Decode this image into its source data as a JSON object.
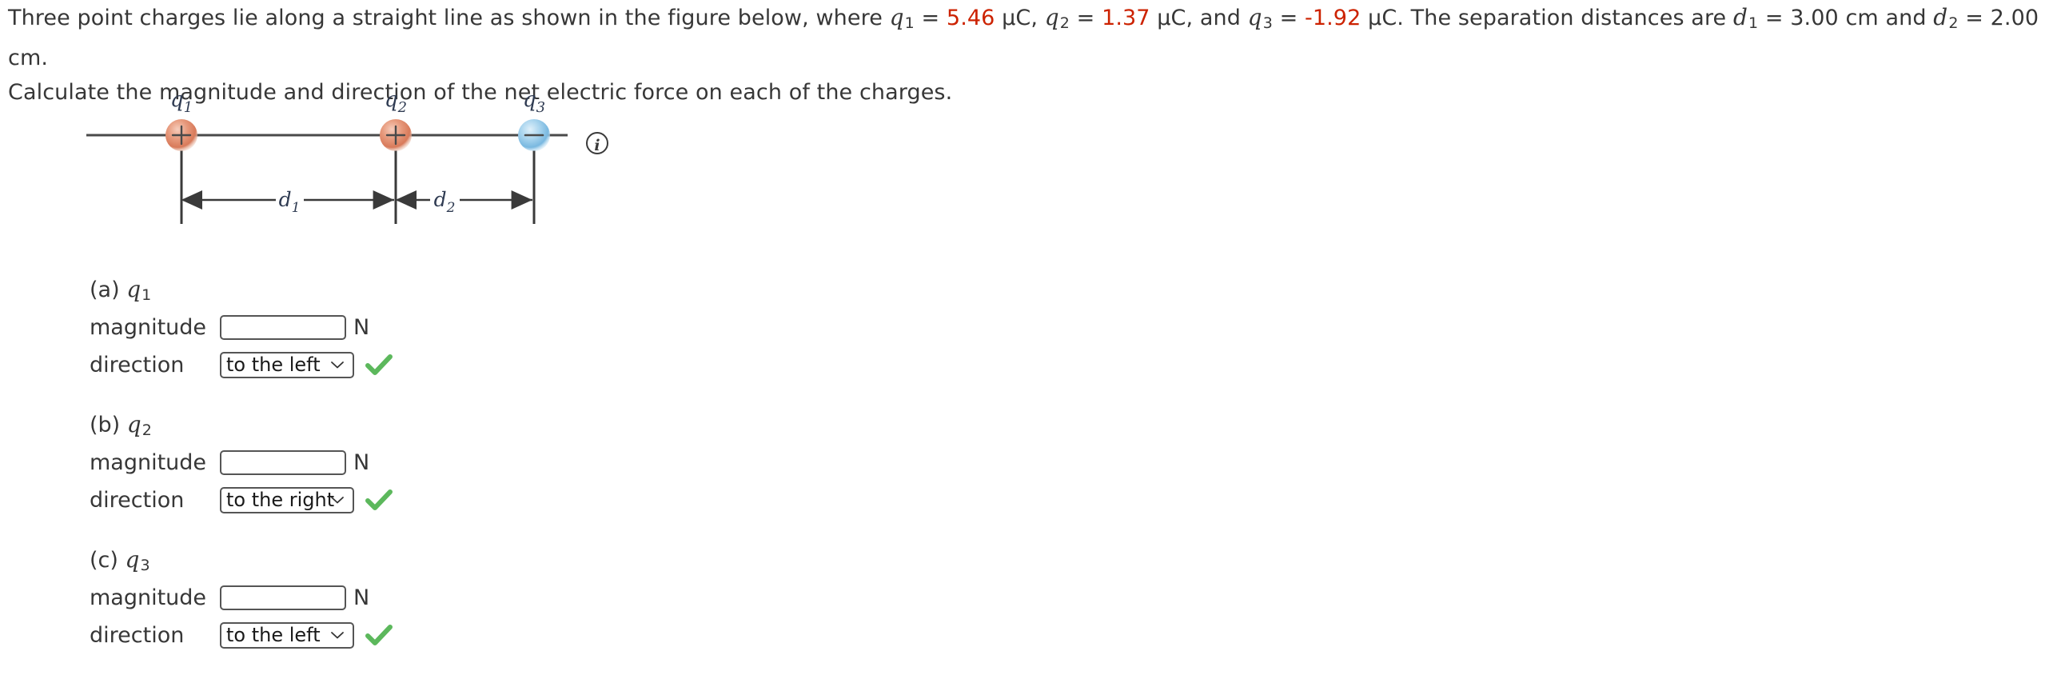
{
  "problem": {
    "line1_part1": "Three point charges lie along a straight line as shown in the figure below, where ",
    "q1_sym": "q",
    "q1_sub": "1",
    "eq1": " = ",
    "q1_val": "5.46",
    "unit1": " µC, ",
    "q2_sym": "q",
    "q2_sub": "2",
    "eq2": " = ",
    "q2_val": "1.37",
    "unit2": " µC, and ",
    "q3_sym": "q",
    "q3_sub": "3",
    "eq3": " = ",
    "q3_val": "-1.92",
    "unit3": " µC. The separation distances are ",
    "d1_sym": "d",
    "d1_sub": "1",
    "eq4": " = ",
    "d1_val": "3.00 cm",
    "and_text": " and ",
    "d2_sym": "d",
    "d2_sub": "2",
    "eq5": " = ",
    "d2_val": "2.00 cm",
    "period": ".",
    "line2": "Calculate the magnitude and direction of the net electric force on each of the charges."
  },
  "figure": {
    "charge1_label": "q",
    "charge1_sub": "1",
    "charge1_sign": "+",
    "charge1_color": "#e08a6e",
    "charge2_label": "q",
    "charge2_sub": "2",
    "charge2_sign": "+",
    "charge2_color": "#e08a6e",
    "charge3_label": "q",
    "charge3_sub": "3",
    "charge3_sign": "−",
    "charge3_color": "#8ec4e6",
    "dim1_label": "d",
    "dim1_sub": "1",
    "dim2_label": "d",
    "dim2_sub": "2",
    "info_icon_label": "i"
  },
  "parts": [
    {
      "title_prefix": "(a) ",
      "title_sym": "q",
      "title_sub": "1",
      "magnitude_label": "magnitude",
      "magnitude_value": "",
      "magnitude_placeholder": "",
      "unit": "N",
      "direction_label": "direction",
      "direction_value": "to the left",
      "status": "correct"
    },
    {
      "title_prefix": "(b) ",
      "title_sym": "q",
      "title_sub": "2",
      "magnitude_label": "magnitude",
      "magnitude_value": "",
      "magnitude_placeholder": "",
      "unit": "N",
      "direction_label": "direction",
      "direction_value": "to the right",
      "status": "correct"
    },
    {
      "title_prefix": "(c) ",
      "title_sym": "q",
      "title_sub": "3",
      "magnitude_label": "magnitude",
      "magnitude_value": "",
      "magnitude_placeholder": "",
      "unit": "N",
      "direction_label": "direction",
      "direction_value": "to the left",
      "status": "correct"
    }
  ],
  "direction_options": [
    "to the left",
    "to the right"
  ],
  "colors": {
    "red_value": "#cc2200",
    "check_green": "#5cb85c",
    "positive_charge": "#e08a6e",
    "negative_charge": "#8ec4e6",
    "text": "#373737"
  }
}
